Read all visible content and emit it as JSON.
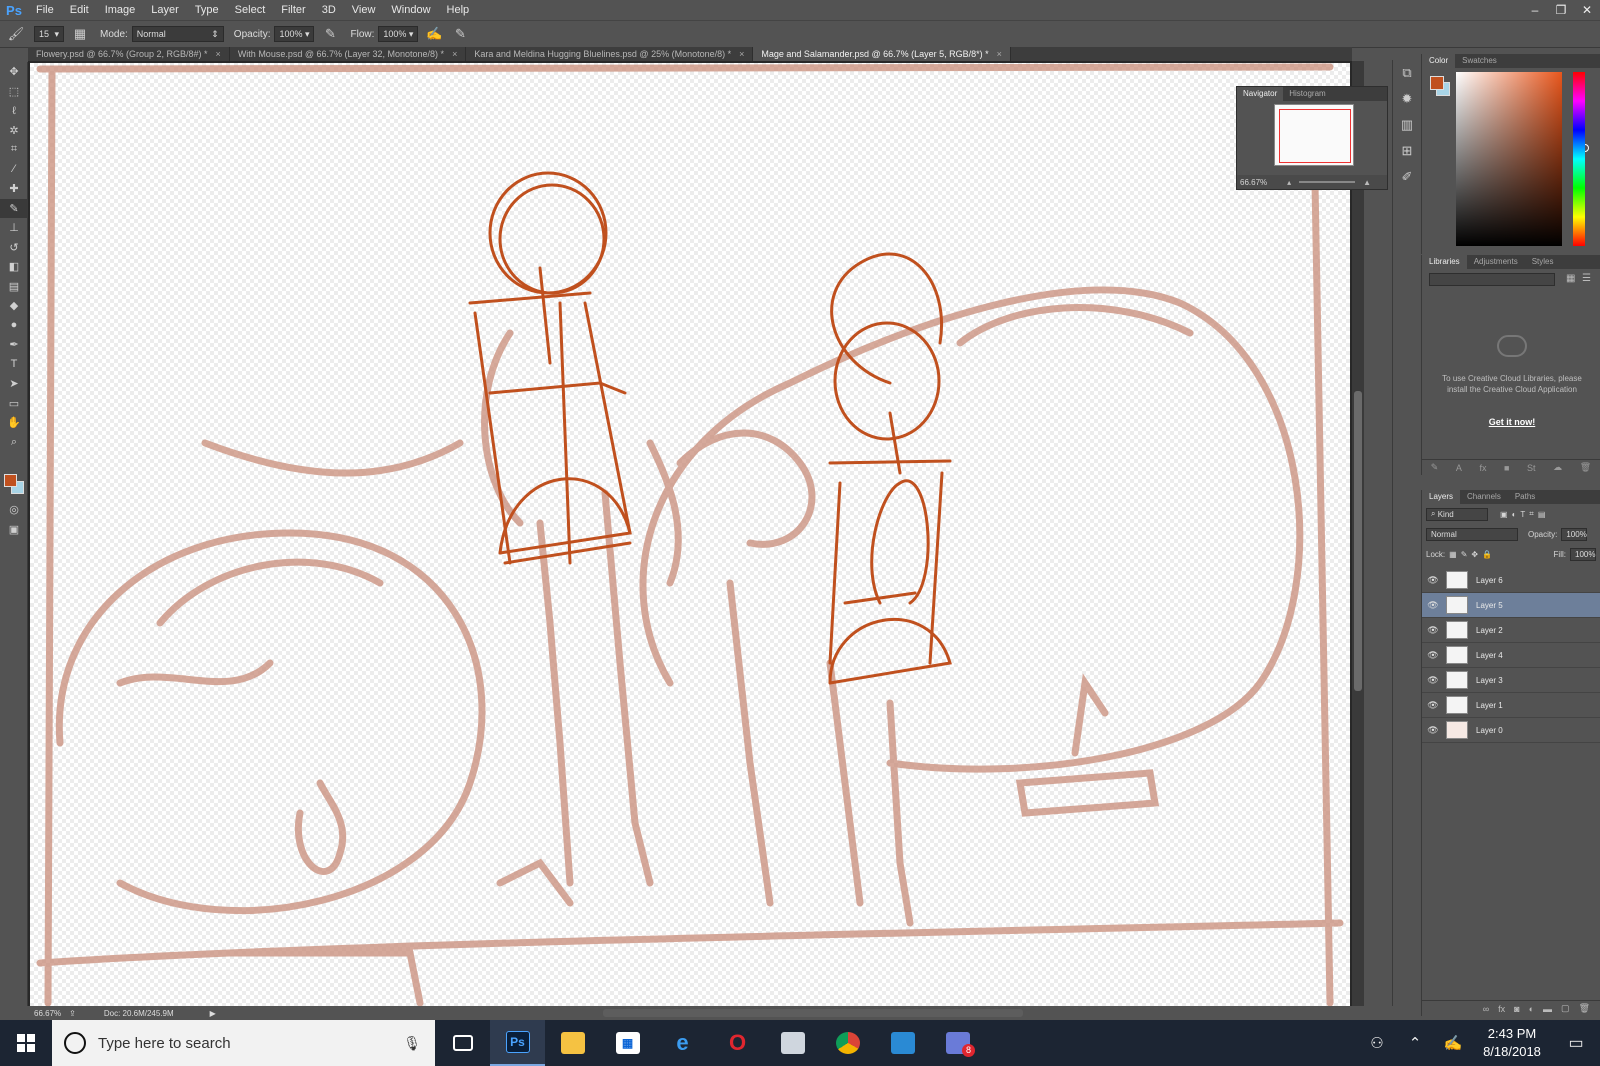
{
  "app": {
    "logo": "Ps"
  },
  "menu": [
    "File",
    "Edit",
    "Image",
    "Layer",
    "Type",
    "Select",
    "Filter",
    "3D",
    "View",
    "Window",
    "Help"
  ],
  "options": {
    "brush_size": "15",
    "mode_label": "Mode:",
    "mode_value": "Normal",
    "opacity_label": "Opacity:",
    "opacity_value": "100%",
    "flow_label": "Flow:",
    "flow_value": "100%"
  },
  "tabs": [
    {
      "label": "Flowery.psd @ 66.7% (Group 2, RGB/8#) *",
      "active": false
    },
    {
      "label": "With Mouse.psd @ 66.7% (Layer 32, Monotone/8) *",
      "active": false
    },
    {
      "label": "Kara and Meldina Hugging Bluelines.psd @ 25% (Monotone/8) *",
      "active": false
    },
    {
      "label": "Mage and Salamander.psd @ 66.7% (Layer 5, RGB/8*) *",
      "active": true
    }
  ],
  "navigator": {
    "tabs": [
      "Navigator",
      "Histogram"
    ],
    "zoom": "66.67%"
  },
  "color_panel": {
    "tabs": [
      "Color",
      "Swatches"
    ],
    "fg": "#c0501e",
    "bg": "#a8d4e6"
  },
  "libraries_panel": {
    "tabs": [
      "Libraries",
      "Adjustments",
      "Styles"
    ],
    "message": "To use Creative Cloud Libraries, please install the Creative Cloud Application",
    "link": "Get it now!"
  },
  "layers_panel": {
    "tabs": [
      "Layers",
      "Channels",
      "Paths"
    ],
    "kind_label": "Kind",
    "blend_mode": "Normal",
    "opacity_label": "Opacity:",
    "opacity_value": "100%",
    "lock_label": "Lock:",
    "fill_label": "Fill:",
    "fill_value": "100%",
    "layers": [
      {
        "name": "Layer 6",
        "selected": false
      },
      {
        "name": "Layer 5",
        "selected": true
      },
      {
        "name": "Layer 2",
        "selected": false
      },
      {
        "name": "Layer 4",
        "selected": false
      },
      {
        "name": "Layer 3",
        "selected": false
      },
      {
        "name": "Layer 1",
        "selected": false
      },
      {
        "name": "Layer 0",
        "selected": false
      }
    ]
  },
  "status": {
    "zoom": "66.67%",
    "doc": "Doc: 20.6M/245.9M"
  },
  "taskbar": {
    "search_placeholder": "Type here to search",
    "apps": [
      "task-view",
      "photoshop",
      "file-explorer",
      "store",
      "edge",
      "opera",
      "mail-scanner",
      "chrome",
      "outlook",
      "teams-chat"
    ],
    "chat_badge": "8",
    "time": "2:43 PM",
    "date": "8/18/2018"
  },
  "colors": {
    "sketch_light": "#c98d7a",
    "sketch_orange": "#c0501e"
  }
}
